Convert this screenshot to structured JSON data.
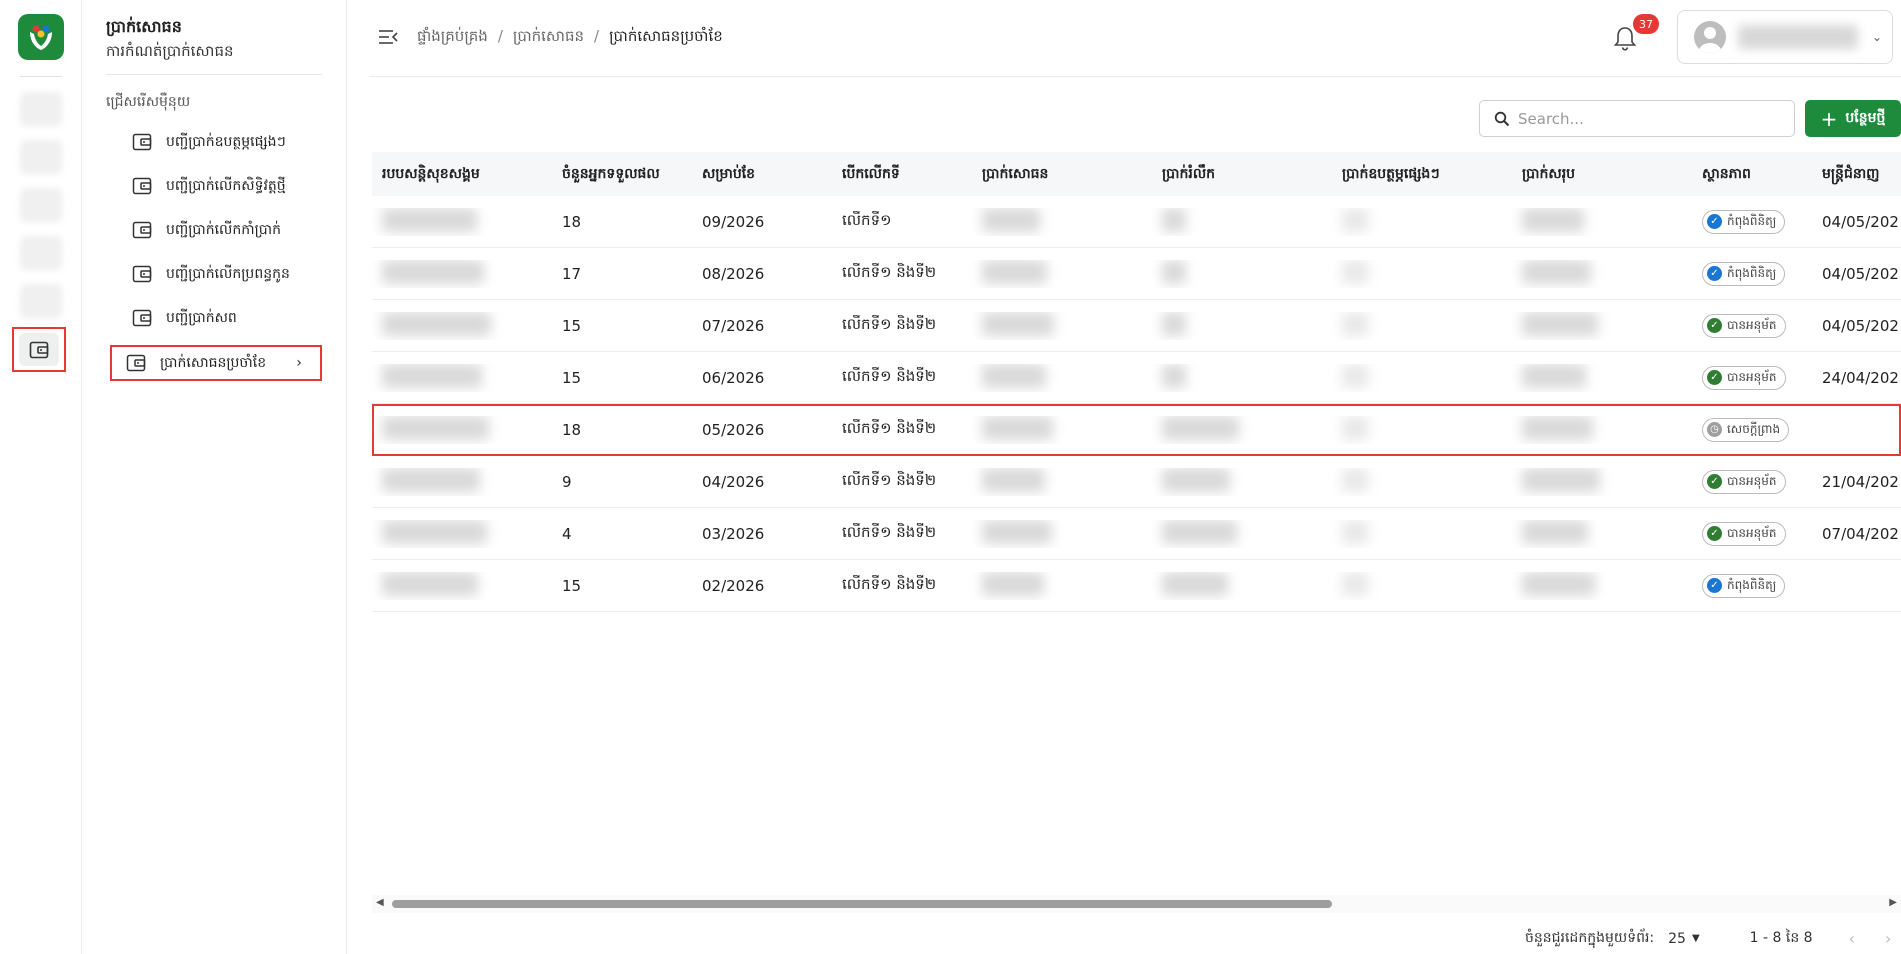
{
  "sidebar": {
    "title": "ប្រាក់សោធន",
    "subtitle": "ការកំណត់ប្រាក់សោធន",
    "section_label": "ជ្រើសរើសម៉ឺនុយ",
    "items": [
      {
        "label": "បញ្ជីប្រាក់ឧបត្ថម្ភផ្សេងៗ"
      },
      {
        "label": "បញ្ជីប្រាក់លើកសិទ្ធិវត្តថ្មី"
      },
      {
        "label": "បញ្ជីប្រាក់លើកកាំប្រាក់"
      },
      {
        "label": "បញ្ជីប្រាក់លើកប្រពន្ធកូន"
      },
      {
        "label": "បញ្ជីប្រាក់សព"
      },
      {
        "label": "ប្រាក់សោធនប្រចាំខែ"
      }
    ]
  },
  "header": {
    "breadcrumb": [
      "ផ្ទាំងគ្រប់គ្រង",
      "ប្រាក់សោធន",
      "ប្រាក់សោធនប្រចាំខែ"
    ],
    "breadcrumb_sep": "/",
    "notification_count": "37"
  },
  "toolbar": {
    "search_placeholder": "Search...",
    "add_label": "បន្ថែមថ្មី"
  },
  "table": {
    "columns": [
      "របបសន្តិសុខសង្គម",
      "ចំនួនអ្នកទទួលផល",
      "សម្រាប់ខែ",
      "បើកលើកទី",
      "ប្រាក់សោធន",
      "ប្រាក់រំលឹក",
      "ប្រាក់ឧបត្ថម្ភផ្សេងៗ",
      "ប្រាក់សរុប",
      "ស្ថានភាព",
      "មន្ត្រីជំនាញ"
    ],
    "rows": [
      {
        "count": "18",
        "month": "09/2026",
        "round": "លើកទី១",
        "status": "កំពុងពិនិត្យ",
        "status_type": "review",
        "officer": "04/05/202"
      },
      {
        "count": "17",
        "month": "08/2026",
        "round": "លើកទី១ និងទី២",
        "status": "កំពុងពិនិត្យ",
        "status_type": "review",
        "officer": "04/05/202"
      },
      {
        "count": "15",
        "month": "07/2026",
        "round": "លើកទី១ និងទី២",
        "status": "បានអនុម័ត",
        "status_type": "approved",
        "officer": "04/05/202"
      },
      {
        "count": "15",
        "month": "06/2026",
        "round": "លើកទី១ និងទី២",
        "status": "បានអនុម័ត",
        "status_type": "approved",
        "officer": "24/04/202"
      },
      {
        "count": "18",
        "month": "05/2026",
        "round": "លើកទី១ និងទី២",
        "status": "សេចក្តីព្រាង",
        "status_type": "draft",
        "officer": ""
      },
      {
        "count": "9",
        "month": "04/2026",
        "round": "លើកទី១ និងទី២",
        "status": "បានអនុម័ត",
        "status_type": "approved",
        "officer": "21/04/202"
      },
      {
        "count": "4",
        "month": "03/2026",
        "round": "លើកទី១ និងទី២",
        "status": "បានអនុម័ត",
        "status_type": "approved",
        "officer": "07/04/202"
      },
      {
        "count": "15",
        "month": "02/2026",
        "round": "លើកទី១ និងទី២",
        "status": "កំពុងពិនិត្យ",
        "status_type": "review",
        "officer": ""
      }
    ]
  },
  "pagination": {
    "rows_per_page_label": "ចំនួនជួរដេកក្នុងមួយទំព័រ:",
    "rows_per_page": "25",
    "range": "1 - 8 នៃ 8"
  },
  "colors": {
    "brand": "#1e8a3c",
    "highlight": "#e53935",
    "review": "#1976d2",
    "approved": "#2e7d32",
    "draft": "#9e9e9e"
  },
  "icons": {
    "logo": "hands-heart-logo",
    "menu_item": "wallet-icon",
    "search": "search-icon",
    "bell": "bell-icon",
    "menu_toggle": "menu-collapse-icon"
  }
}
